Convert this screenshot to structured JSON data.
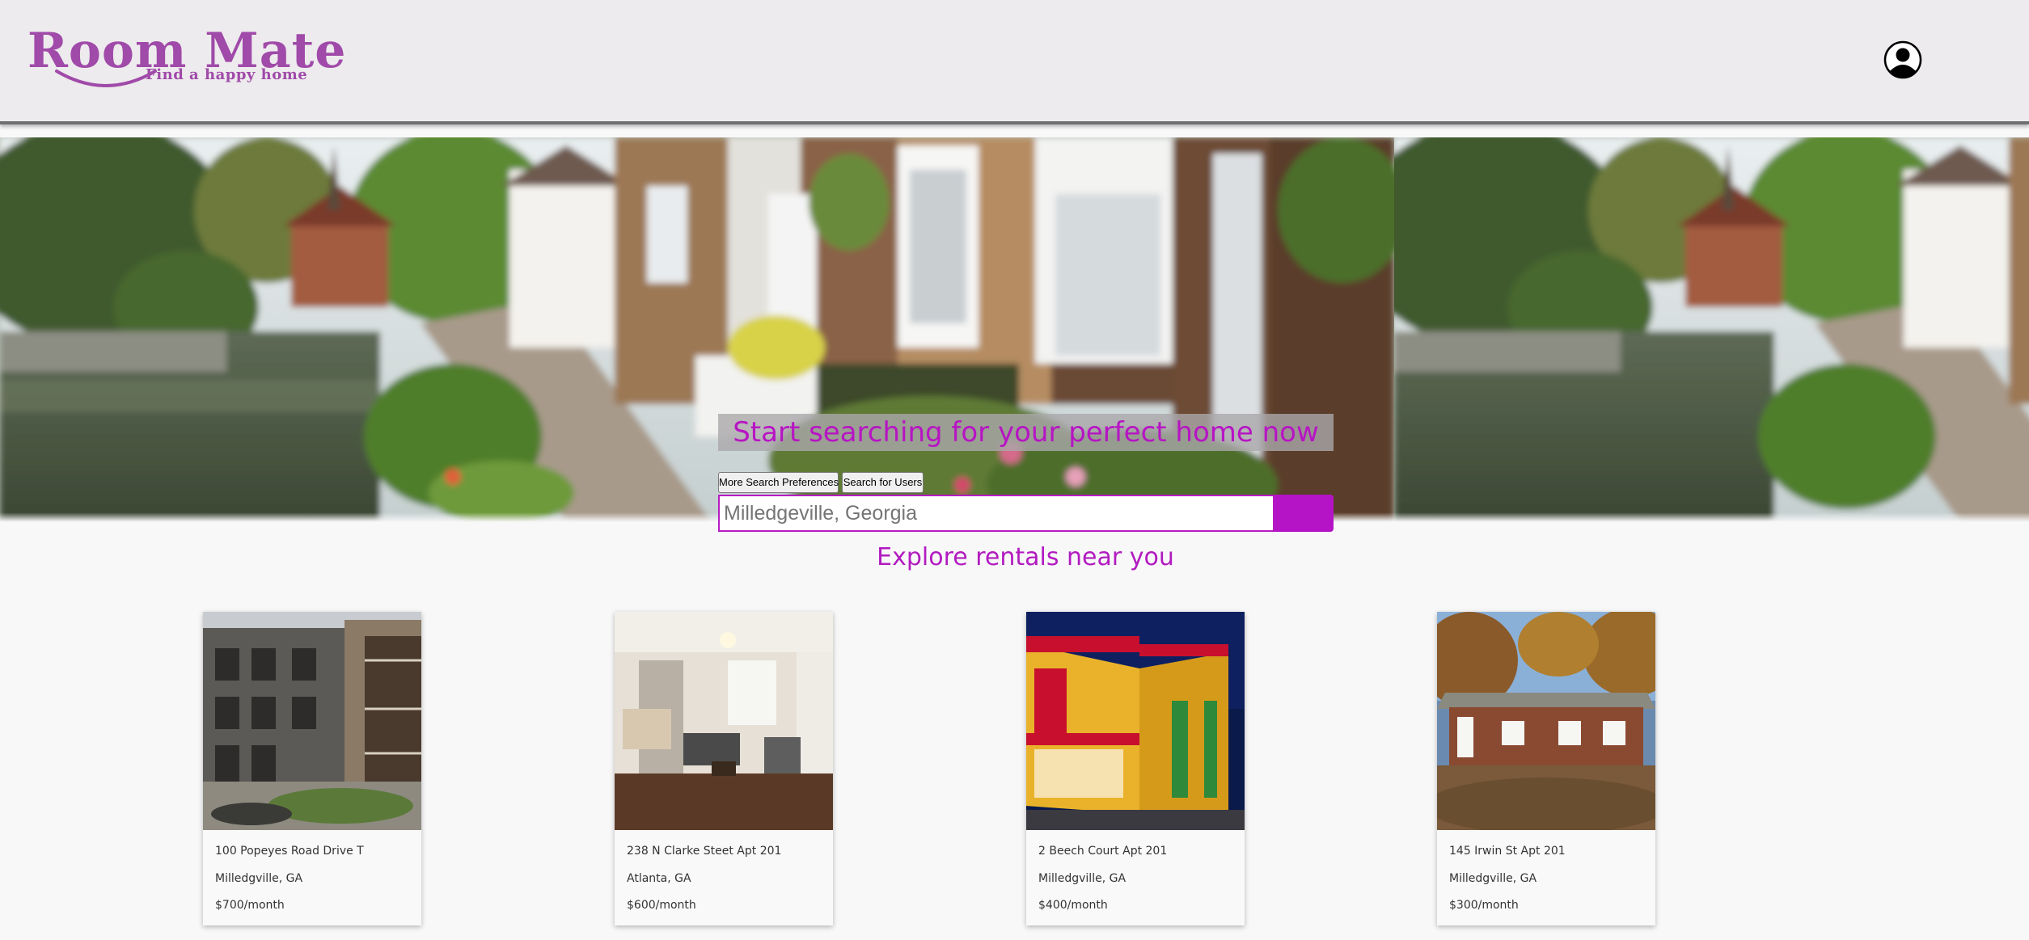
{
  "brand": {
    "name": "Room Mate",
    "tagline": "Find a happy home",
    "color": "#a04aa9"
  },
  "header": {
    "profile_icon": "user-circle-icon"
  },
  "hero": {
    "heading": "Start searching for your perfect home now",
    "buttons": {
      "more_prefs": "More Search Preferences",
      "search_users": "Search for Users"
    },
    "search": {
      "placeholder": "Milledgeville, Georgia",
      "button_color": "#b414c5"
    }
  },
  "explore": {
    "title": "Explore rentals near you"
  },
  "listings": [
    {
      "address": "100 Popeyes Road Drive T",
      "city": "Milledgville, GA",
      "price": "$700/month"
    },
    {
      "address": "238 N Clarke Steet Apt 201",
      "city": "Atlanta, GA",
      "price": "$600/month"
    },
    {
      "address": "2 Beech Court Apt 201",
      "city": "Milledgville, GA",
      "price": "$400/month"
    },
    {
      "address": "145 Irwin St Apt 201",
      "city": "Milledgville, GA",
      "price": "$300/month"
    }
  ]
}
